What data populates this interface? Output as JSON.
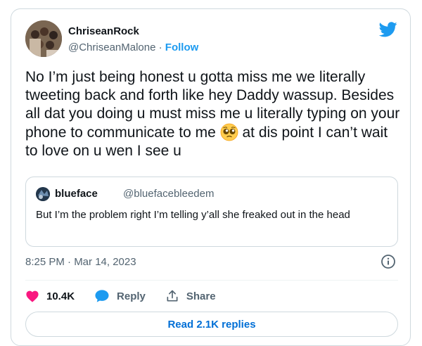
{
  "tweet": {
    "author_name": "ChriseanRock",
    "author_handle": "@ChriseanMalone",
    "separator": "·",
    "follow_label": "Follow",
    "text_before_emoji": "No I’m just being honest u gotta miss me we literally tweeting back and forth like hey Daddy wassup. Besides all dat you doing u must miss me u literally typing on your phone to communicate to me ",
    "text_after_emoji": " at dis point I can’t wait to love on u wen I see u",
    "emoji": "pleading-face",
    "timestamp": "8:25 PM · Mar 14, 2023"
  },
  "quoted_tweet": {
    "author_name": "blueface",
    "author_handle": "@bluefacebleedem",
    "text": "But I’m the problem right I’m telling y’all she freaked out in the head"
  },
  "actions": {
    "like_count": "10.4K",
    "reply_label": "Reply",
    "share_label": "Share",
    "read_replies_label": "Read 2.1K replies"
  },
  "icons": {
    "brand": "twitter-bird-icon",
    "info": "info-icon",
    "like": "heart-icon",
    "reply": "reply-bubble-icon",
    "share": "share-icon"
  },
  "colors": {
    "brand": "#1d9bf0",
    "like": "#f91880",
    "link": "#006fd6",
    "muted": "#536471",
    "border": "#cfd9de"
  }
}
